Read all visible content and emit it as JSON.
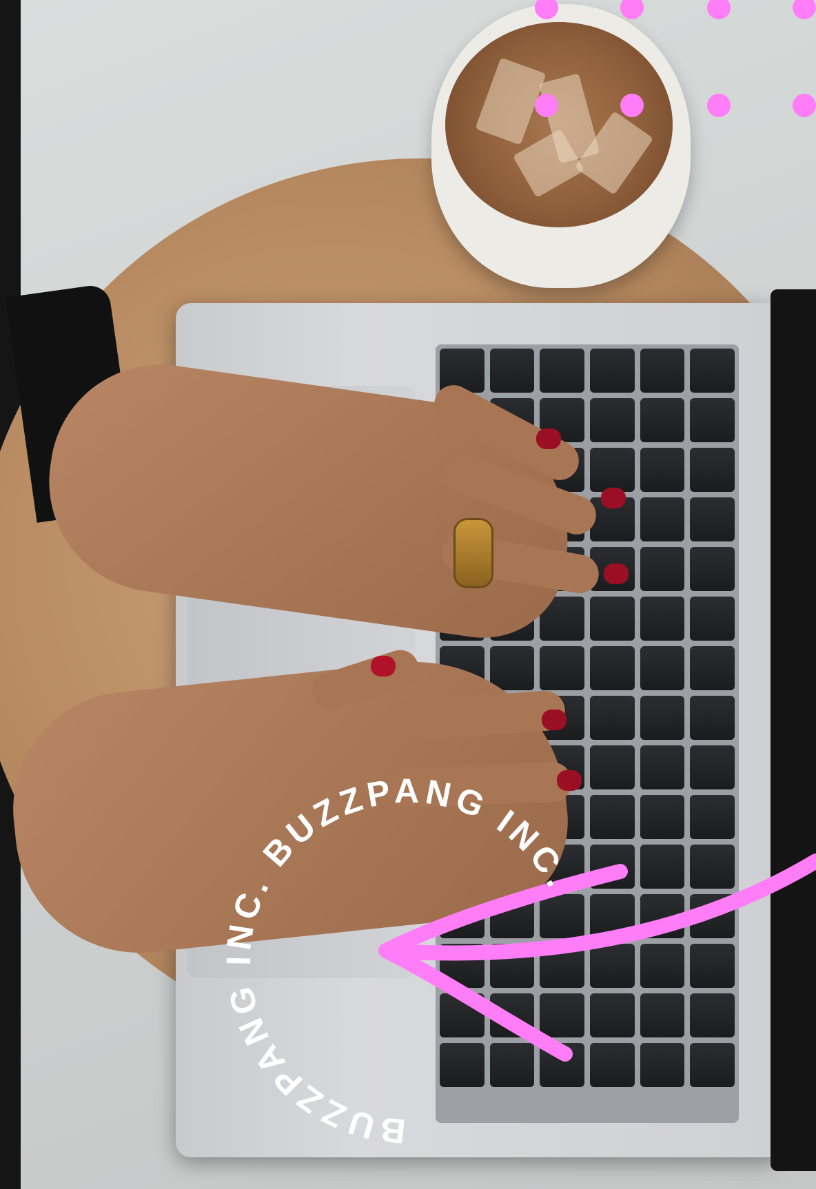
{
  "scene": {
    "description_items": [
      "coffee-cup",
      "laptop",
      "hands",
      "round-wooden-table"
    ],
    "accent_color": "#ff7ef7"
  },
  "badge": {
    "circular_text": "BUZZPANG INC. BUZZPANG INC."
  },
  "decor": {
    "dots_count": 8,
    "arrow_icon": "curved-arrow-icon"
  }
}
